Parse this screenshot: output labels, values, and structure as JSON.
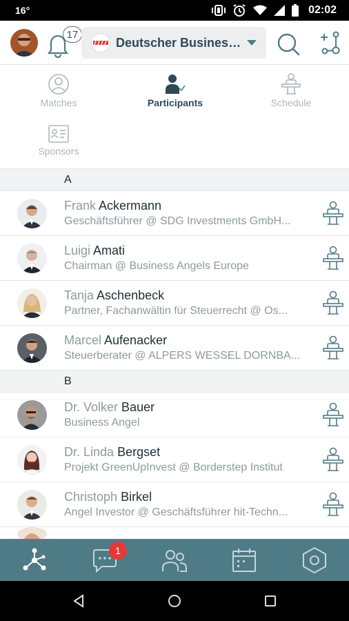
{
  "statusbar": {
    "temperature": "16°",
    "time": "02:02"
  },
  "topbar": {
    "notifications_count": "17",
    "event_name": "Deutscher Business...",
    "event_logo": "red-striped-logo",
    "icons": [
      "avatar",
      "bell-icon",
      "caret-down-icon",
      "search-icon",
      "network-add-icon"
    ]
  },
  "tabs": [
    {
      "label": "Matches",
      "icon": "person-circle-icon",
      "active": false
    },
    {
      "label": "Participants",
      "icon": "person-check-icon",
      "active": true
    },
    {
      "label": "Schedule",
      "icon": "meeting-table-icon",
      "active": false
    },
    {
      "label": "Sponsors",
      "icon": "id-card-icon",
      "active": false
    }
  ],
  "sections": [
    {
      "letter": "A",
      "people": [
        {
          "first": "Frank",
          "last": "Ackermann",
          "subtitle": "Geschäftsführer @ SDG Investments GmbH..."
        },
        {
          "first": "Luigi",
          "last": "Amati",
          "subtitle": "Chairman @ Business Angels Europe"
        },
        {
          "first": "Tanja",
          "last": "Aschenbeck",
          "subtitle": "Partner, Fachanwältin für Steuerrecht @ Os..."
        },
        {
          "first": "Marcel",
          "last": "Aufenacker",
          "subtitle": "Steuerberater @ ALPERS WESSEL DORNBA..."
        }
      ]
    },
    {
      "letter": "B",
      "people": [
        {
          "first": "Dr. Volker",
          "last": "Bauer",
          "subtitle": "Business Angel"
        },
        {
          "first": "Dr. Linda",
          "last": "Bergset",
          "subtitle": "Projekt GreenUpInvest @ Borderstep Institut"
        },
        {
          "first": "Christoph",
          "last": "Birkel",
          "subtitle": "Angel Investor @ Geschäftsführer hit-Techn..."
        }
      ]
    }
  ],
  "bottomnav": {
    "items": [
      "network-icon",
      "chat-icon",
      "people-icon",
      "calendar-icon",
      "hexagon-settings-icon"
    ],
    "chat_badge": "1"
  },
  "colors": {
    "accent": "#4f7b86",
    "text_dark": "#2c4a57",
    "muted": "#8c9aa0",
    "badge": "#e53935"
  }
}
